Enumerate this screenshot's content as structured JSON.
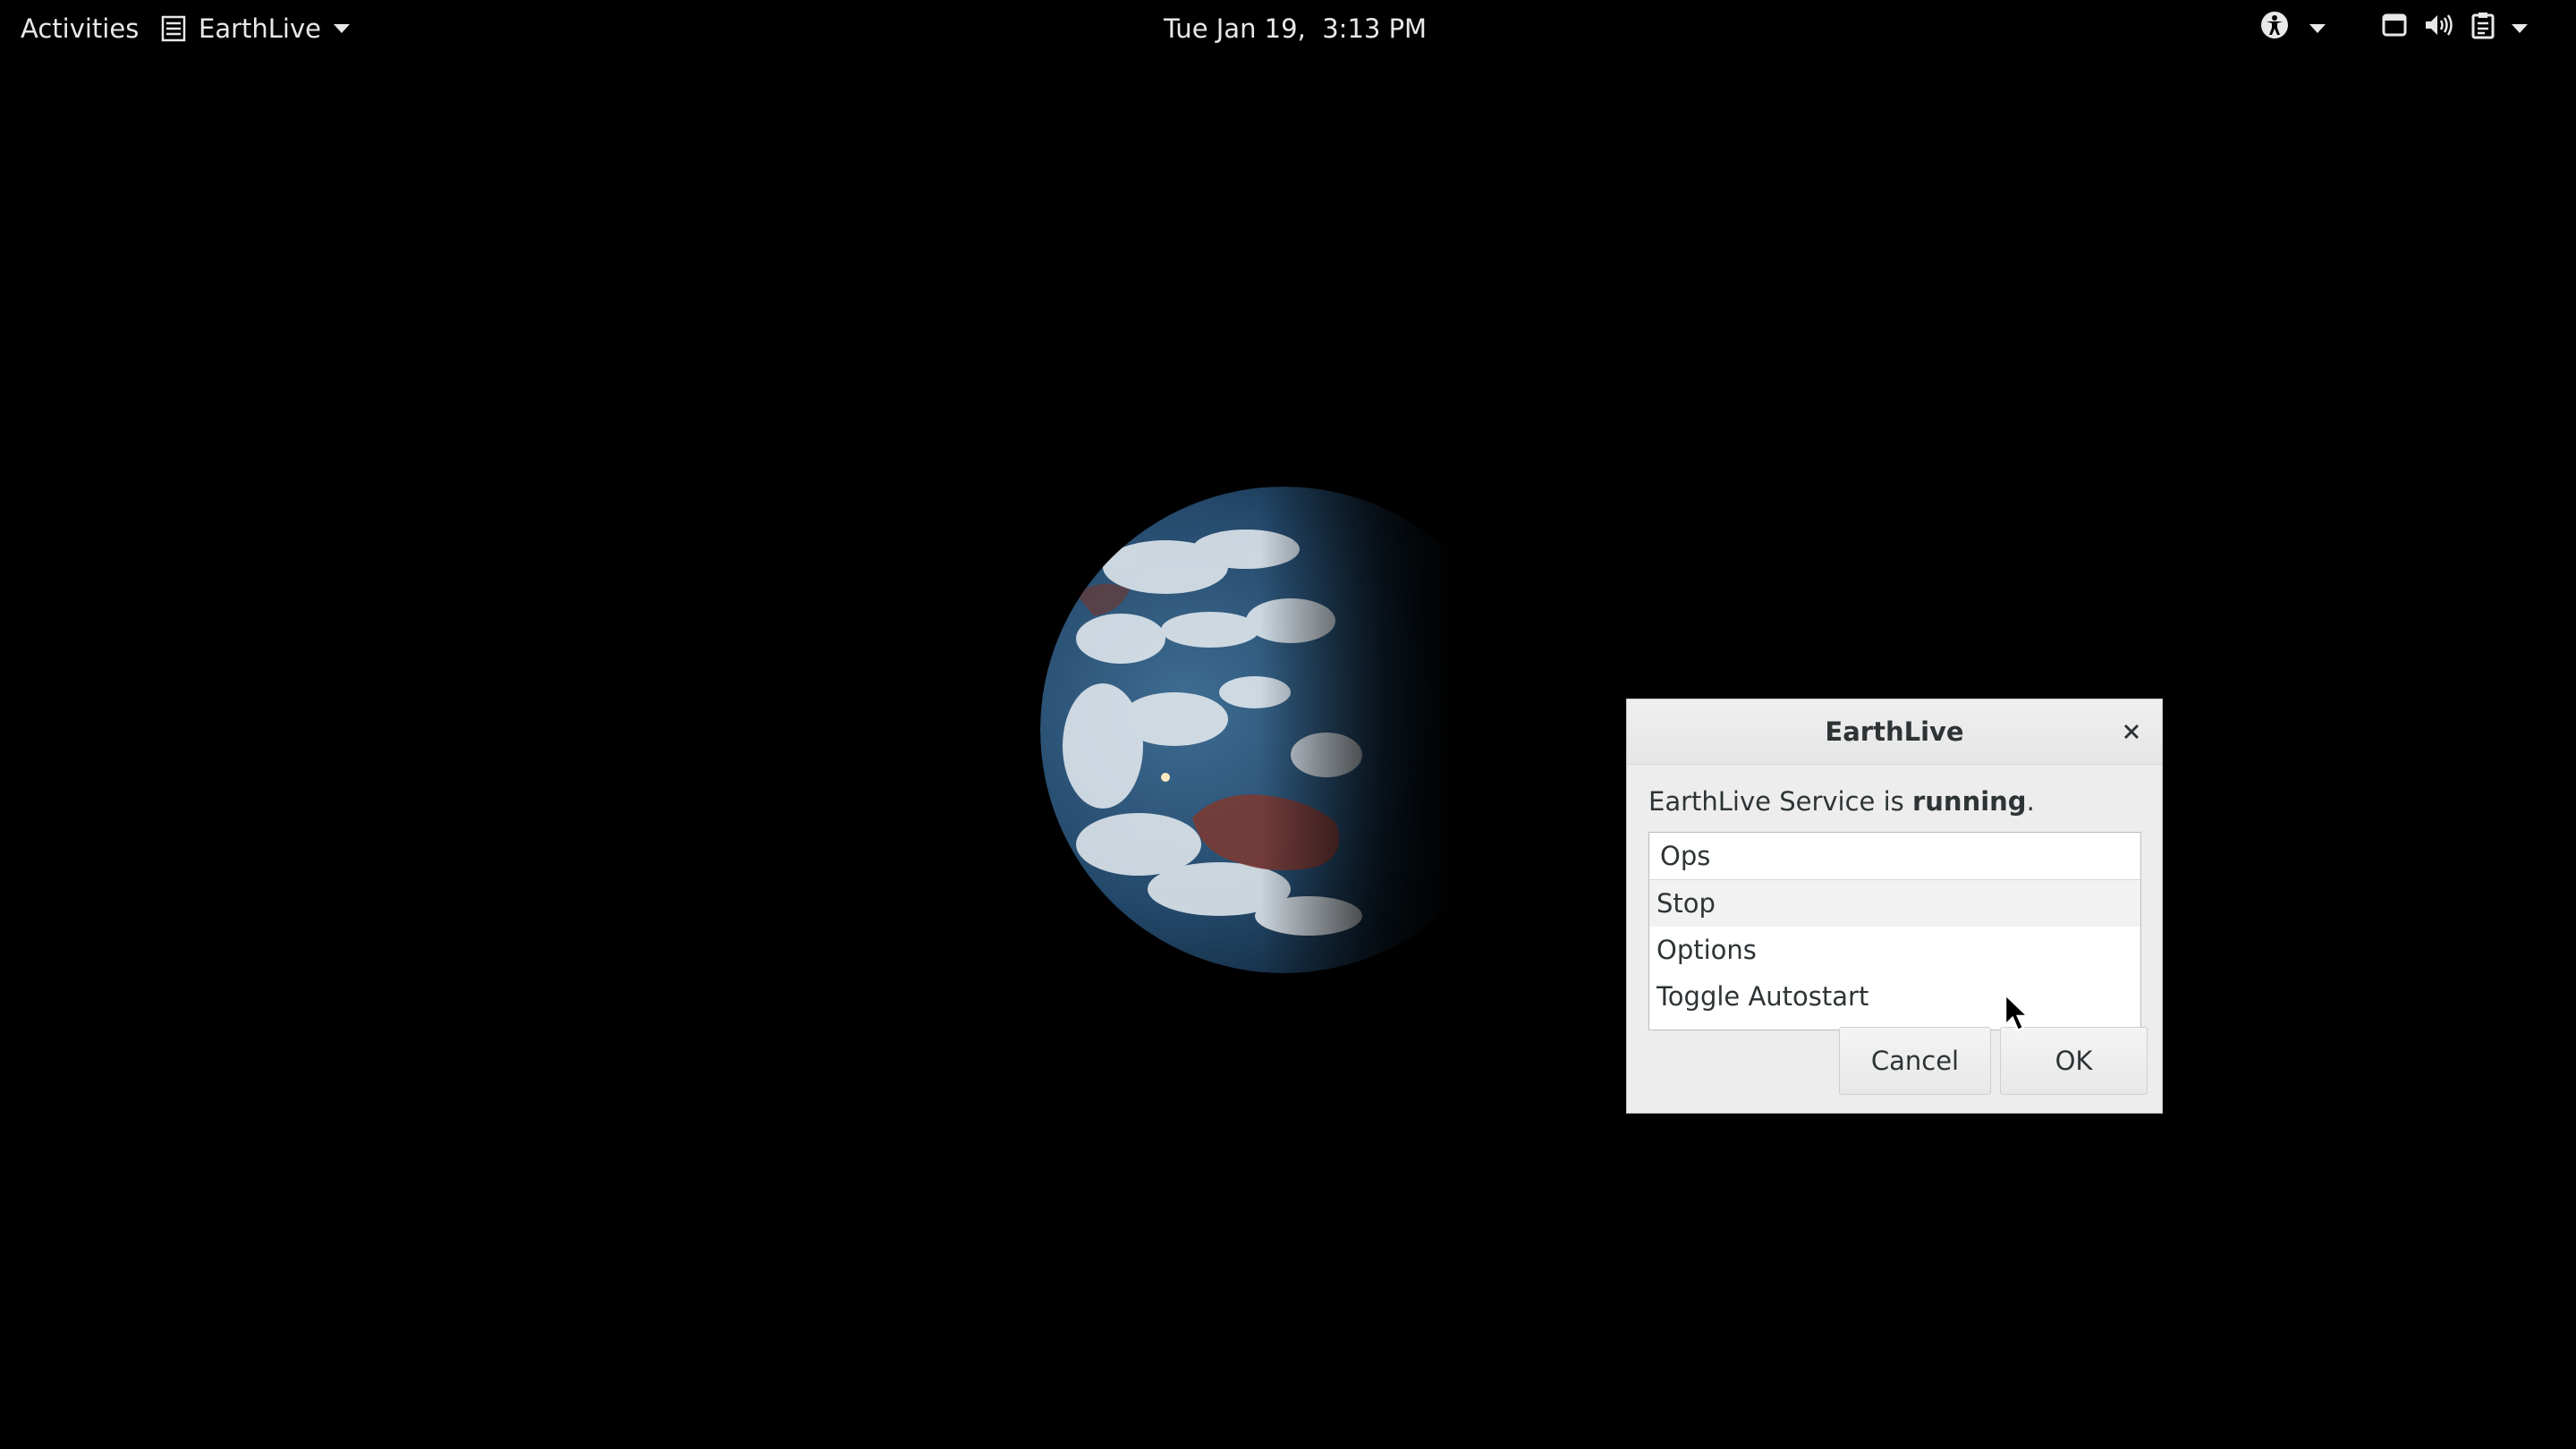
{
  "topbar": {
    "activities": "Activities",
    "app_name": "EarthLive",
    "clock": "Tue Jan 19,  3:13 PM",
    "icons": [
      "accessibility-icon",
      "window-icon",
      "volume-icon",
      "clipboard-icon"
    ]
  },
  "dialog": {
    "title": "EarthLive",
    "status_prefix": "EarthLive Service is ",
    "status_value": "running",
    "status_suffix": ".",
    "list_header": "Ops",
    "items": [
      "Stop",
      "Options",
      "Toggle Autostart"
    ],
    "cancel_label": "Cancel",
    "ok_label": "OK"
  },
  "colors": {
    "background": "#000000",
    "dialog_bg": "#ededed",
    "text": "#2e3436"
  }
}
